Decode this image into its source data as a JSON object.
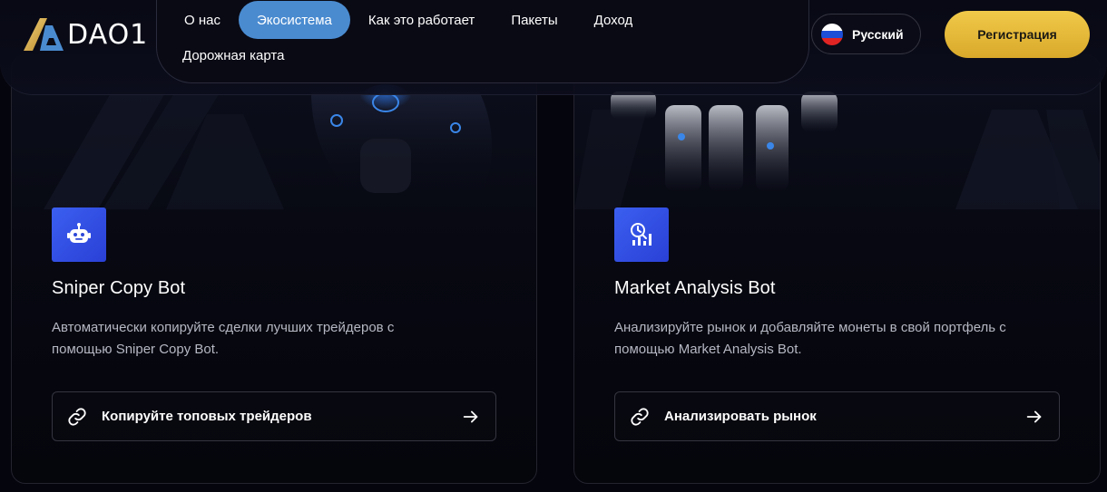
{
  "header": {
    "logo_text": "DAO1",
    "nav": [
      {
        "label": "О нас",
        "active": false
      },
      {
        "label": "Экосистема",
        "active": true
      },
      {
        "label": "Как это работает",
        "active": false
      },
      {
        "label": "Пакеты",
        "active": false
      },
      {
        "label": "Доход",
        "active": false
      },
      {
        "label": "Дорожная карта",
        "active": false
      }
    ],
    "language": {
      "label": "Русский",
      "flag_icon": "russia-flag-icon"
    },
    "register_label": "Регистрация"
  },
  "cards": [
    {
      "icon": "robot-icon",
      "title": "Sniper Copy Bot",
      "description": "Автоматически копируйте сделки лучших трейдеров с помощью Sniper Copy Bot.",
      "button_label": "Копируйте топовых трейдеров",
      "button_icon": "link-icon",
      "arrow_icon": "arrow-right-icon"
    },
    {
      "icon": "analytics-icon",
      "title": "Market Analysis Bot",
      "description": "Анализируйте рынок и добавляйте монеты в свой портфель с помощью Market Analysis Bot.",
      "button_label": "Анализировать рынок",
      "button_icon": "link-icon",
      "arrow_icon": "arrow-right-icon"
    }
  ],
  "colors": {
    "background": "#05050d",
    "nav_active": "#4a8bd0",
    "register_button": "#e3b637",
    "card_icon": "#3355e6"
  }
}
